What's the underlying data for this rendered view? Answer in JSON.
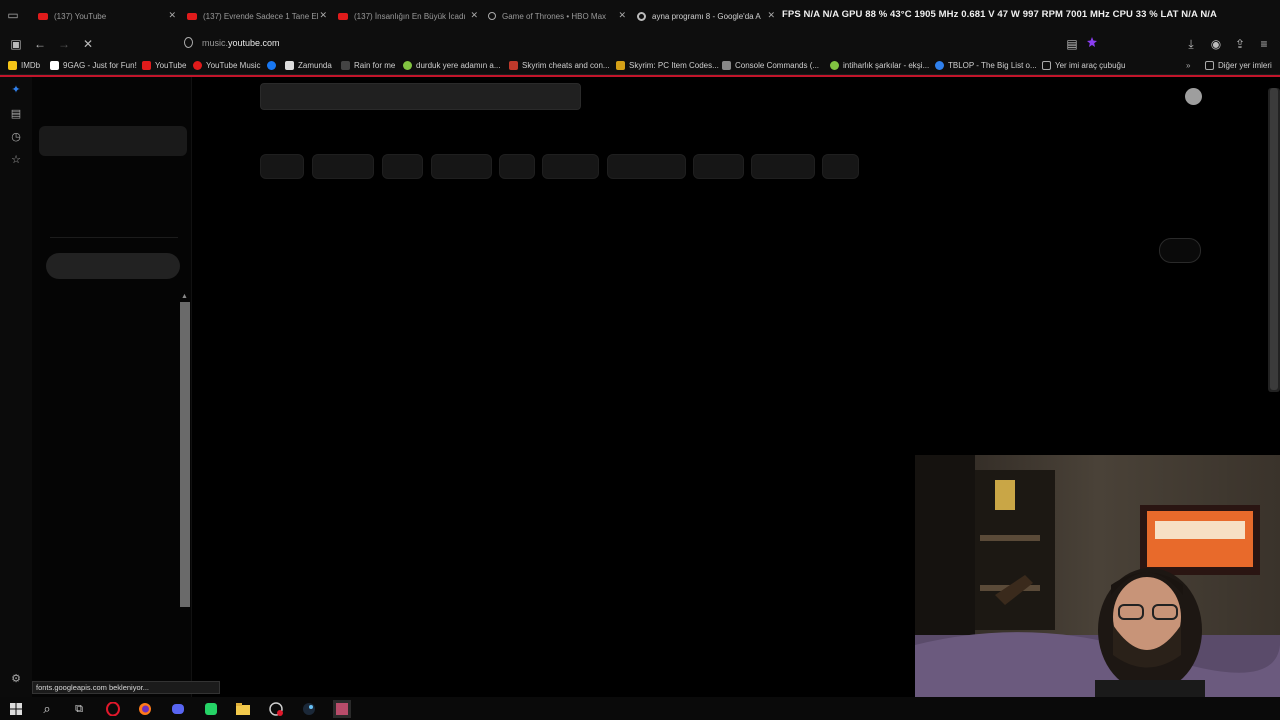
{
  "tabs": [
    {
      "title": "(137) YouTube",
      "icon": "youtube-icon"
    },
    {
      "title": "(137) Evrende Sadece 1 Tane El",
      "icon": "youtube-icon"
    },
    {
      "title": "(137) İnsanlığın En Büyük İcadı",
      "icon": "youtube-icon"
    },
    {
      "title": "Game of Thrones • HBO Max",
      "icon": "globe-icon"
    },
    {
      "title": "ayna programı 8 - Google'da A",
      "icon": "google-icon"
    }
  ],
  "hw_overlay": "FPS N/A N/A GPU 88 % 43°C 1905 MHz 0.681 V 47 W 997 RPM 7001 MHz CPU 33 % LAT N/A N/A",
  "address_bar": {
    "url_prefix": "music.",
    "url_domain": "youtube.com"
  },
  "bookmarks": [
    {
      "label": "IMDb",
      "color": "#f5c518"
    },
    {
      "label": "9GAG - Just for Fun!",
      "color": "#ffffff"
    },
    {
      "label": "YouTube",
      "color": "#e01b1b"
    },
    {
      "label": "YouTube Music",
      "color": "#e01b1b"
    },
    {
      "label": "",
      "color": "#1877f2"
    },
    {
      "label": "Zamunda",
      "color": "#dddddd"
    },
    {
      "label": "Rain for me",
      "color": "#444444"
    },
    {
      "label": "durduk yere adamın a...",
      "color": "#81c341"
    },
    {
      "label": "Skyrim cheats and con...",
      "color": "#c0392b"
    },
    {
      "label": "Skyrim: PC Item Codes...",
      "color": "#d4a017"
    },
    {
      "label": "Console Commands (...",
      "color": "#888888"
    },
    {
      "label": "intiharlık şarkılar - ekşi...",
      "color": "#81c341"
    },
    {
      "label": "TBLOP - The Big List o...",
      "color": "#2f80ed"
    },
    {
      "label": "Yer imi araç çubuğu",
      "color": "#aaaaaa"
    },
    {
      "label": "Diğer yer imleri",
      "color": "#aaaaaa"
    }
  ],
  "status_text": "fonts.googleapis.com bekleniyor...",
  "accent": "#c2152b"
}
